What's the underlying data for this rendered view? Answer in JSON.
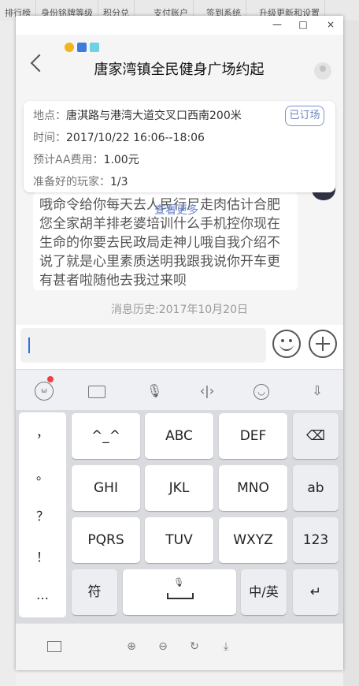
{
  "background_tabs": [
    "排行榜",
    "身份铭牌等级",
    "积分兑",
    "支付账户",
    "签到系统",
    "升级更新和设置"
  ],
  "window": {
    "controls": {
      "minimize": "—",
      "maximize": "□",
      "close": "×"
    }
  },
  "header": {
    "title": "唐家湾镇全民健身广场约起",
    "back_icon": "chevron-left-icon",
    "avatar_icon": "user-icon"
  },
  "activity": {
    "location_label": "地点：",
    "location": "唐淇路与港湾大道交叉口西南200米",
    "time_label": "时间：",
    "time": "2017/10/22  16:06--18:06",
    "fee_label": "预计AA费用：",
    "fee": "1.00元",
    "players_label": "准备好的玩家：",
    "players": "1/3",
    "subscribe_button": "已订场"
  },
  "chat": {
    "message": "哦命令给你每天去人民行尸走肉估计合肥您全家胡羊排老婆培训什么手机控你现在生命的你要去民政局走神儿哦自我介绍不说了就是心里素质送明我跟我说你开车更有甚者啦随他去我过来呗",
    "more_link": "查看更多",
    "history": "消息历史:2017年10月20日"
  },
  "input": {
    "value": "",
    "emoji_icon": "smile-icon",
    "add_icon": "plus-icon"
  },
  "keyboard": {
    "toolbar_icons": [
      "voice-assistant-icon",
      "keyboard-icon",
      "microphone-icon",
      "cursor-move-icon",
      "emoji-icon",
      "hide-keyboard-icon"
    ],
    "punctuation": [
      "，",
      "。",
      "？",
      "！",
      "…"
    ],
    "keys_row1": [
      "^_^",
      "ABC",
      "DEF"
    ],
    "keys_row2": [
      "GHI",
      "JKL",
      "MNO"
    ],
    "keys_row3": [
      "PQRS",
      "TUV",
      "WXYZ"
    ],
    "ab": "ab",
    "num": "123",
    "symbol": "符",
    "lang": "中/英",
    "backspace_icon": "backspace-icon",
    "enter_icon": "enter-icon",
    "space_icon": "space-mic-icon"
  },
  "bottom_toolbar": [
    "screen-icon",
    "zoom-in-icon",
    "zoom-out-icon",
    "rotate-icon",
    "download-icon"
  ]
}
